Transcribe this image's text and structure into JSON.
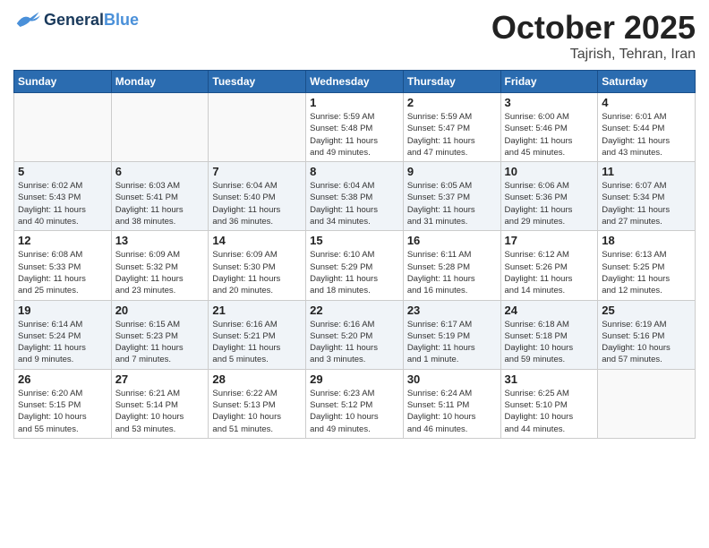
{
  "header": {
    "logo_general": "General",
    "logo_blue": "Blue",
    "month_title": "October 2025",
    "location": "Tajrish, Tehran, Iran"
  },
  "weekdays": [
    "Sunday",
    "Monday",
    "Tuesday",
    "Wednesday",
    "Thursday",
    "Friday",
    "Saturday"
  ],
  "weeks": [
    [
      {
        "day": "",
        "info": ""
      },
      {
        "day": "",
        "info": ""
      },
      {
        "day": "",
        "info": ""
      },
      {
        "day": "1",
        "info": "Sunrise: 5:59 AM\nSunset: 5:48 PM\nDaylight: 11 hours\nand 49 minutes."
      },
      {
        "day": "2",
        "info": "Sunrise: 5:59 AM\nSunset: 5:47 PM\nDaylight: 11 hours\nand 47 minutes."
      },
      {
        "day": "3",
        "info": "Sunrise: 6:00 AM\nSunset: 5:46 PM\nDaylight: 11 hours\nand 45 minutes."
      },
      {
        "day": "4",
        "info": "Sunrise: 6:01 AM\nSunset: 5:44 PM\nDaylight: 11 hours\nand 43 minutes."
      }
    ],
    [
      {
        "day": "5",
        "info": "Sunrise: 6:02 AM\nSunset: 5:43 PM\nDaylight: 11 hours\nand 40 minutes."
      },
      {
        "day": "6",
        "info": "Sunrise: 6:03 AM\nSunset: 5:41 PM\nDaylight: 11 hours\nand 38 minutes."
      },
      {
        "day": "7",
        "info": "Sunrise: 6:04 AM\nSunset: 5:40 PM\nDaylight: 11 hours\nand 36 minutes."
      },
      {
        "day": "8",
        "info": "Sunrise: 6:04 AM\nSunset: 5:38 PM\nDaylight: 11 hours\nand 34 minutes."
      },
      {
        "day": "9",
        "info": "Sunrise: 6:05 AM\nSunset: 5:37 PM\nDaylight: 11 hours\nand 31 minutes."
      },
      {
        "day": "10",
        "info": "Sunrise: 6:06 AM\nSunset: 5:36 PM\nDaylight: 11 hours\nand 29 minutes."
      },
      {
        "day": "11",
        "info": "Sunrise: 6:07 AM\nSunset: 5:34 PM\nDaylight: 11 hours\nand 27 minutes."
      }
    ],
    [
      {
        "day": "12",
        "info": "Sunrise: 6:08 AM\nSunset: 5:33 PM\nDaylight: 11 hours\nand 25 minutes."
      },
      {
        "day": "13",
        "info": "Sunrise: 6:09 AM\nSunset: 5:32 PM\nDaylight: 11 hours\nand 23 minutes."
      },
      {
        "day": "14",
        "info": "Sunrise: 6:09 AM\nSunset: 5:30 PM\nDaylight: 11 hours\nand 20 minutes."
      },
      {
        "day": "15",
        "info": "Sunrise: 6:10 AM\nSunset: 5:29 PM\nDaylight: 11 hours\nand 18 minutes."
      },
      {
        "day": "16",
        "info": "Sunrise: 6:11 AM\nSunset: 5:28 PM\nDaylight: 11 hours\nand 16 minutes."
      },
      {
        "day": "17",
        "info": "Sunrise: 6:12 AM\nSunset: 5:26 PM\nDaylight: 11 hours\nand 14 minutes."
      },
      {
        "day": "18",
        "info": "Sunrise: 6:13 AM\nSunset: 5:25 PM\nDaylight: 11 hours\nand 12 minutes."
      }
    ],
    [
      {
        "day": "19",
        "info": "Sunrise: 6:14 AM\nSunset: 5:24 PM\nDaylight: 11 hours\nand 9 minutes."
      },
      {
        "day": "20",
        "info": "Sunrise: 6:15 AM\nSunset: 5:23 PM\nDaylight: 11 hours\nand 7 minutes."
      },
      {
        "day": "21",
        "info": "Sunrise: 6:16 AM\nSunset: 5:21 PM\nDaylight: 11 hours\nand 5 minutes."
      },
      {
        "day": "22",
        "info": "Sunrise: 6:16 AM\nSunset: 5:20 PM\nDaylight: 11 hours\nand 3 minutes."
      },
      {
        "day": "23",
        "info": "Sunrise: 6:17 AM\nSunset: 5:19 PM\nDaylight: 11 hours\nand 1 minute."
      },
      {
        "day": "24",
        "info": "Sunrise: 6:18 AM\nSunset: 5:18 PM\nDaylight: 10 hours\nand 59 minutes."
      },
      {
        "day": "25",
        "info": "Sunrise: 6:19 AM\nSunset: 5:16 PM\nDaylight: 10 hours\nand 57 minutes."
      }
    ],
    [
      {
        "day": "26",
        "info": "Sunrise: 6:20 AM\nSunset: 5:15 PM\nDaylight: 10 hours\nand 55 minutes."
      },
      {
        "day": "27",
        "info": "Sunrise: 6:21 AM\nSunset: 5:14 PM\nDaylight: 10 hours\nand 53 minutes."
      },
      {
        "day": "28",
        "info": "Sunrise: 6:22 AM\nSunset: 5:13 PM\nDaylight: 10 hours\nand 51 minutes."
      },
      {
        "day": "29",
        "info": "Sunrise: 6:23 AM\nSunset: 5:12 PM\nDaylight: 10 hours\nand 49 minutes."
      },
      {
        "day": "30",
        "info": "Sunrise: 6:24 AM\nSunset: 5:11 PM\nDaylight: 10 hours\nand 46 minutes."
      },
      {
        "day": "31",
        "info": "Sunrise: 6:25 AM\nSunset: 5:10 PM\nDaylight: 10 hours\nand 44 minutes."
      },
      {
        "day": "",
        "info": ""
      }
    ]
  ]
}
